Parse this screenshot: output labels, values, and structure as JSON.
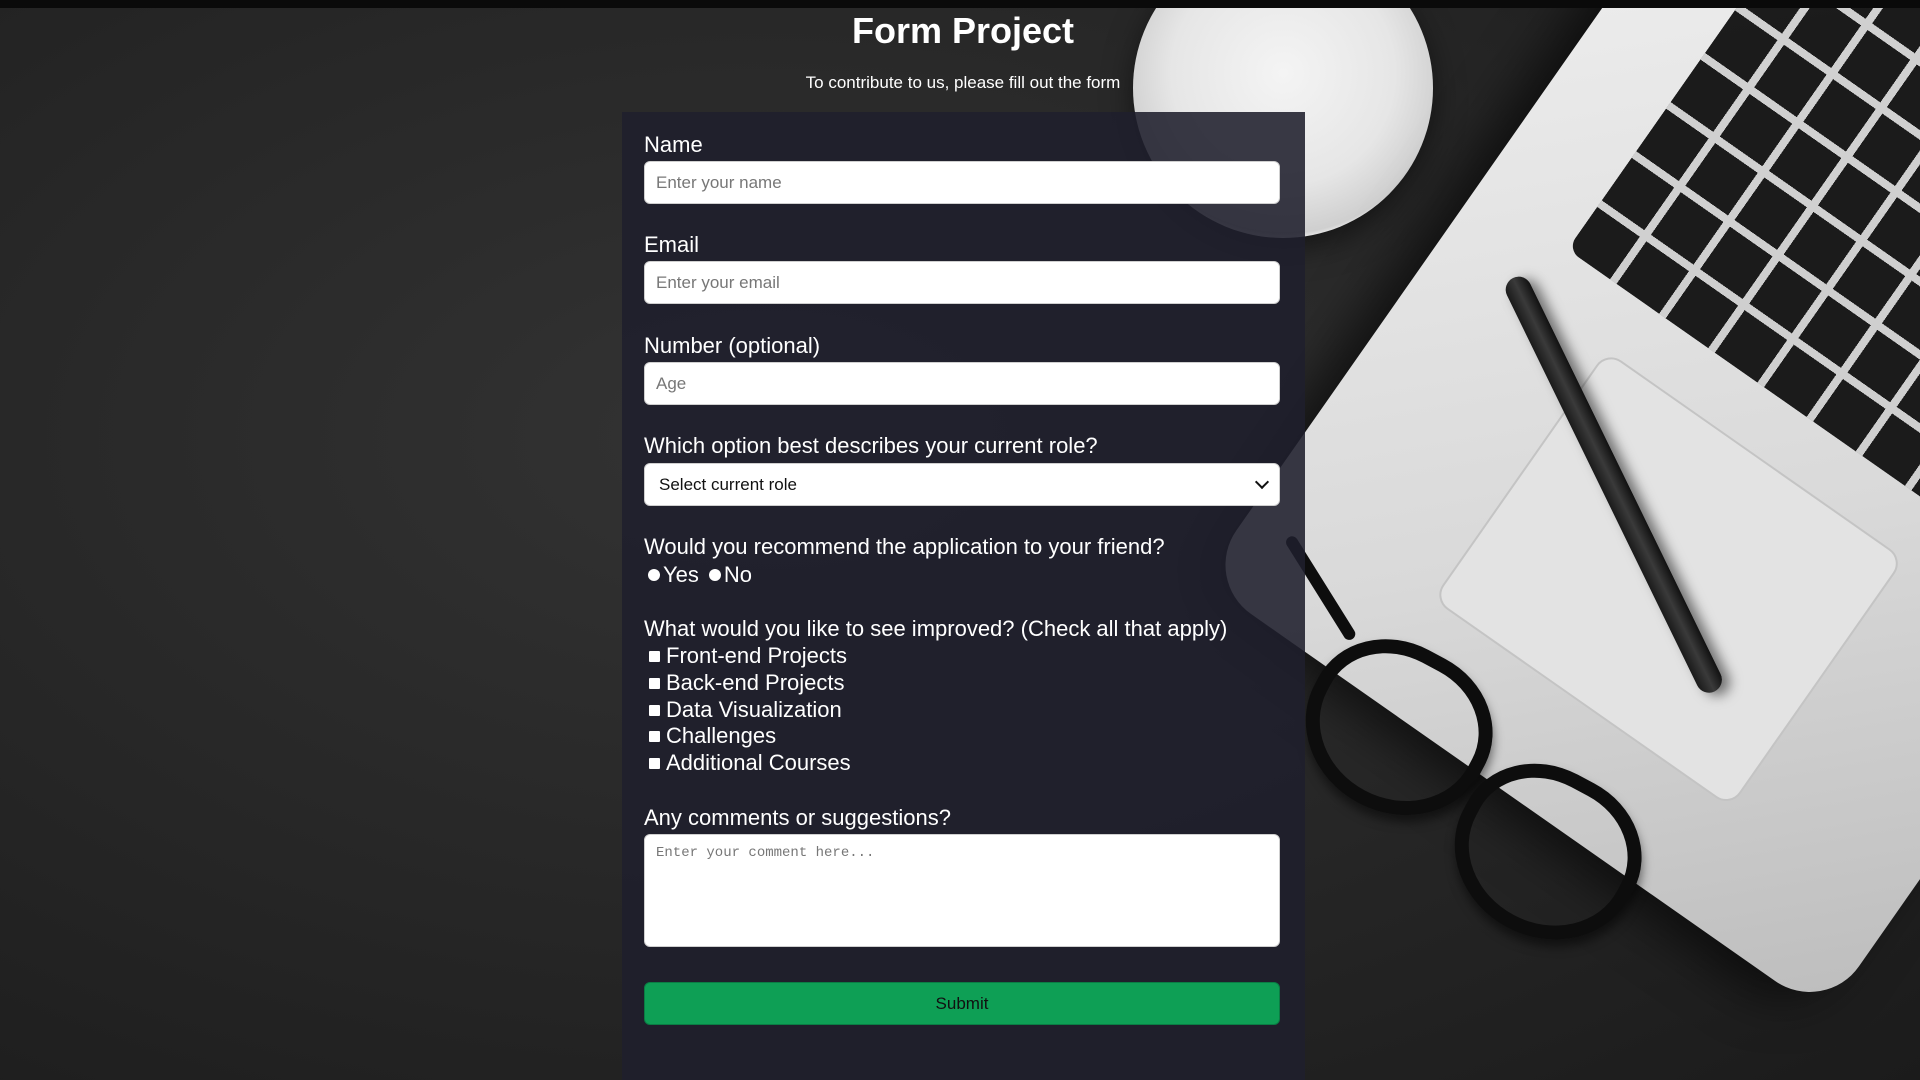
{
  "header": {
    "title": "Form Project",
    "subtitle": "To contribute to us, please fill out the form"
  },
  "form": {
    "name": {
      "label": "Name",
      "placeholder": "Enter your name"
    },
    "email": {
      "label": "Email",
      "placeholder": "Enter your email"
    },
    "number": {
      "label": "Number (optional)",
      "placeholder": "Age"
    },
    "role": {
      "label": "Which option best describes your current role?",
      "selected": "Select current role"
    },
    "recommend": {
      "label": "Would you recommend the application to your friend?",
      "options": [
        "Yes",
        "No"
      ]
    },
    "improve": {
      "label": "What would you like to see improved? (Check all that apply)",
      "options": [
        "Front-end Projects",
        "Back-end Projects",
        "Data Visualization",
        "Challenges",
        "Additional Courses"
      ]
    },
    "comments": {
      "label": "Any comments or suggestions?",
      "placeholder": "Enter your comment here..."
    },
    "submit_label": "Submit"
  },
  "colors": {
    "panel": "#1f1f2c",
    "submit": "#0e9f55"
  }
}
